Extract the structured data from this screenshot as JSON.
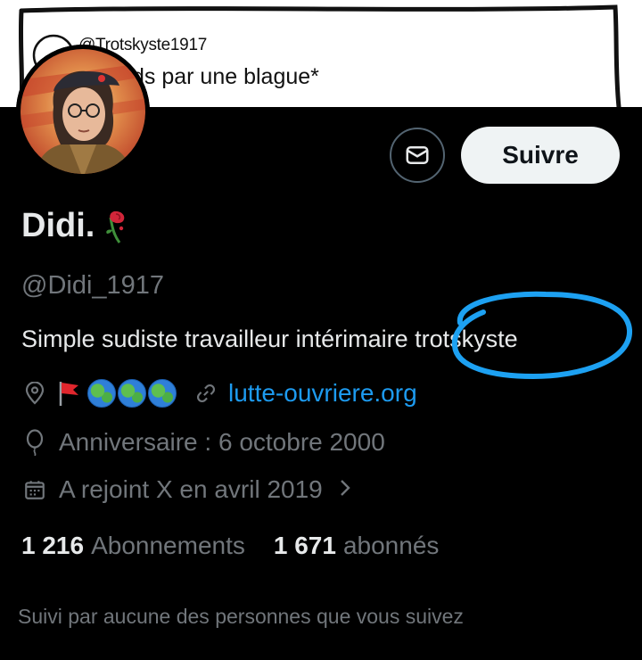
{
  "banner": {
    "handle": "@Trotskyste1917",
    "text": "ds par une blague*"
  },
  "actions": {
    "message_icon": "envelope-icon",
    "follow_label": "Suivre"
  },
  "profile": {
    "name": "Didi.",
    "name_emoji": "wilted-rose-icon",
    "handle": "@Didi_1917",
    "bio": "Simple sudiste travailleur intérimaire trotskyste",
    "location_icon": "location-pin-icon",
    "location_emojis": [
      "red-flag-icon",
      "globe-icon",
      "globe-icon",
      "globe-icon"
    ],
    "website": "lutte-ouvriere.org",
    "birthday": "Anniversaire : 6 octobre 2000",
    "joined": "A rejoint X en avril 2019"
  },
  "stats": {
    "following_count": "1 216",
    "following_label": "Abonnements",
    "followers_count": "1 671",
    "followers_label": "abonnés"
  },
  "followed_by": "Suivi par aucune des personnes que vous suivez",
  "colors": {
    "background": "#000000",
    "text": "#e7e9ea",
    "muted": "#71767b",
    "link": "#1d9bf0",
    "highlight_circle": "#1da1f2"
  }
}
